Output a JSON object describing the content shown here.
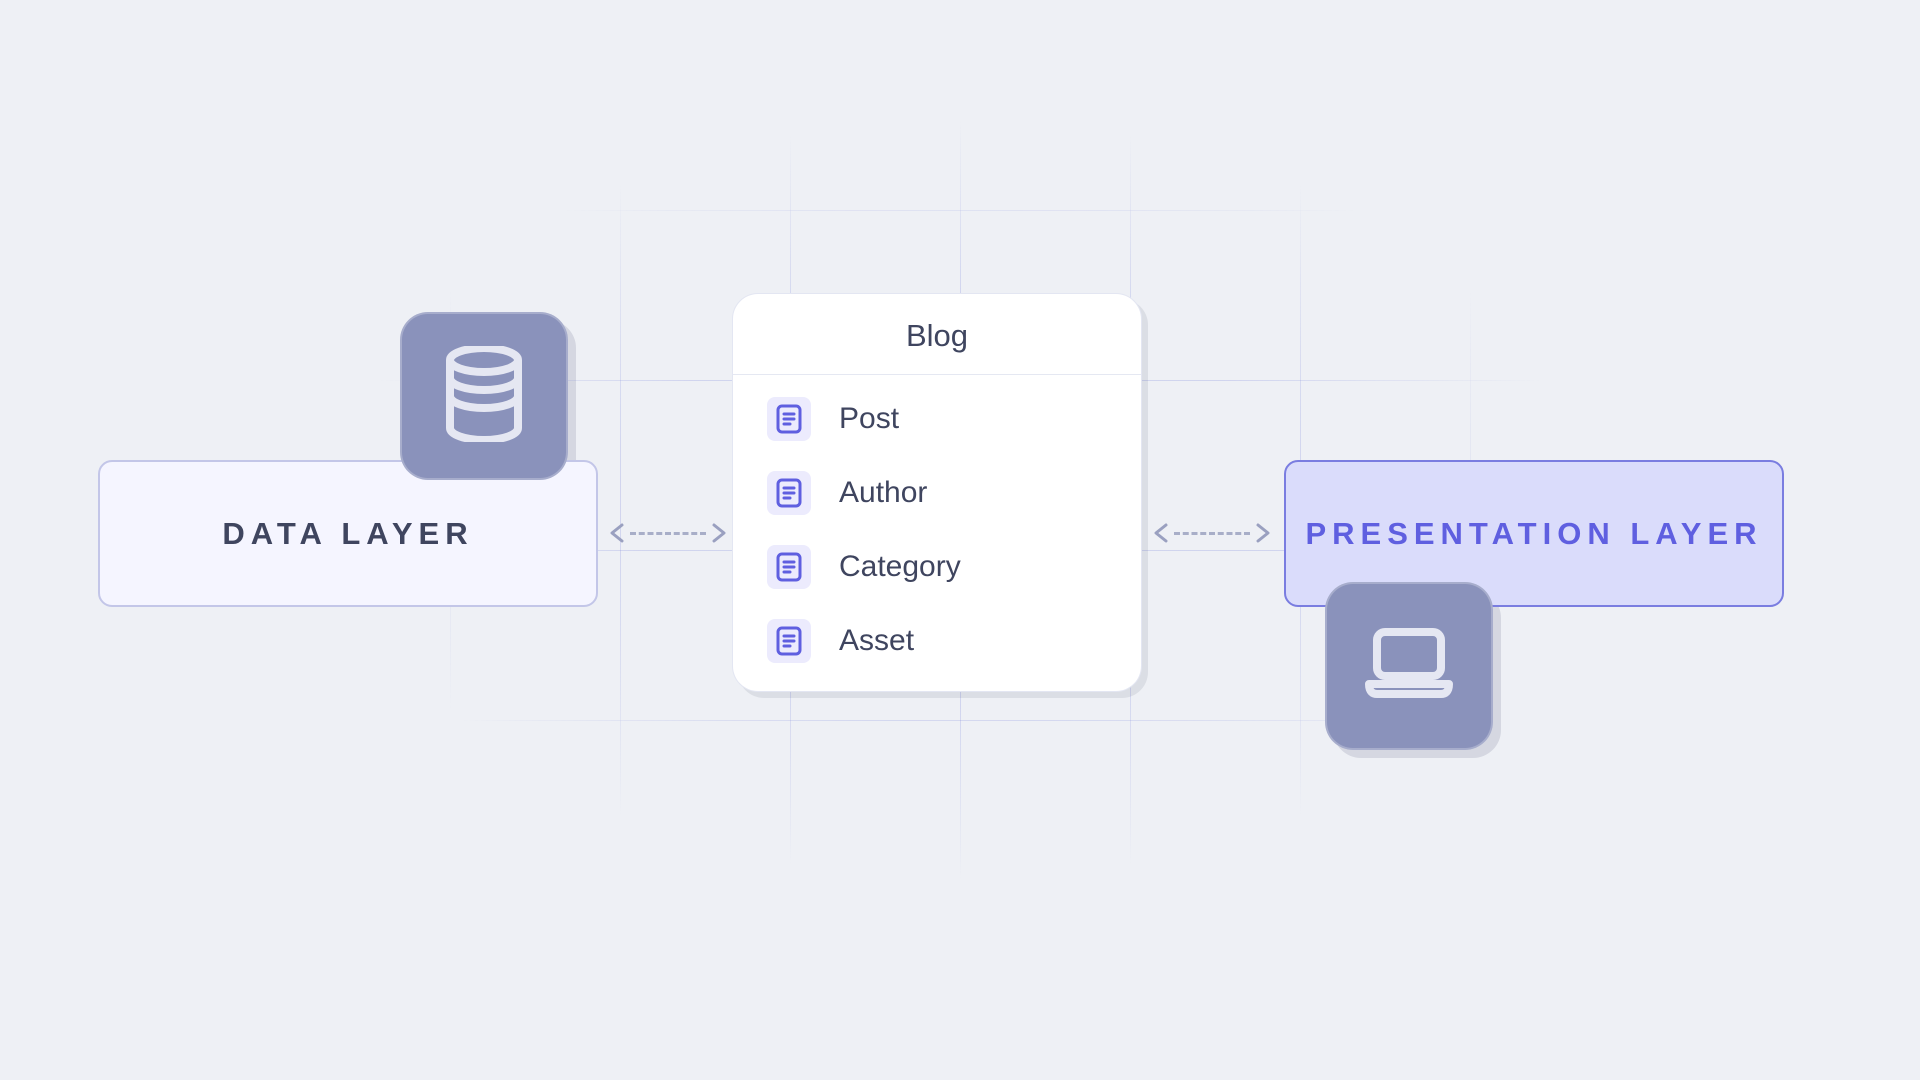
{
  "left_layer": {
    "label": "DATA LAYER"
  },
  "right_layer": {
    "label": "PRESENTATION LAYER"
  },
  "center_card": {
    "title": "Blog",
    "items": [
      {
        "label": "Post"
      },
      {
        "label": "Author"
      },
      {
        "label": "Category"
      },
      {
        "label": "Asset"
      }
    ]
  }
}
